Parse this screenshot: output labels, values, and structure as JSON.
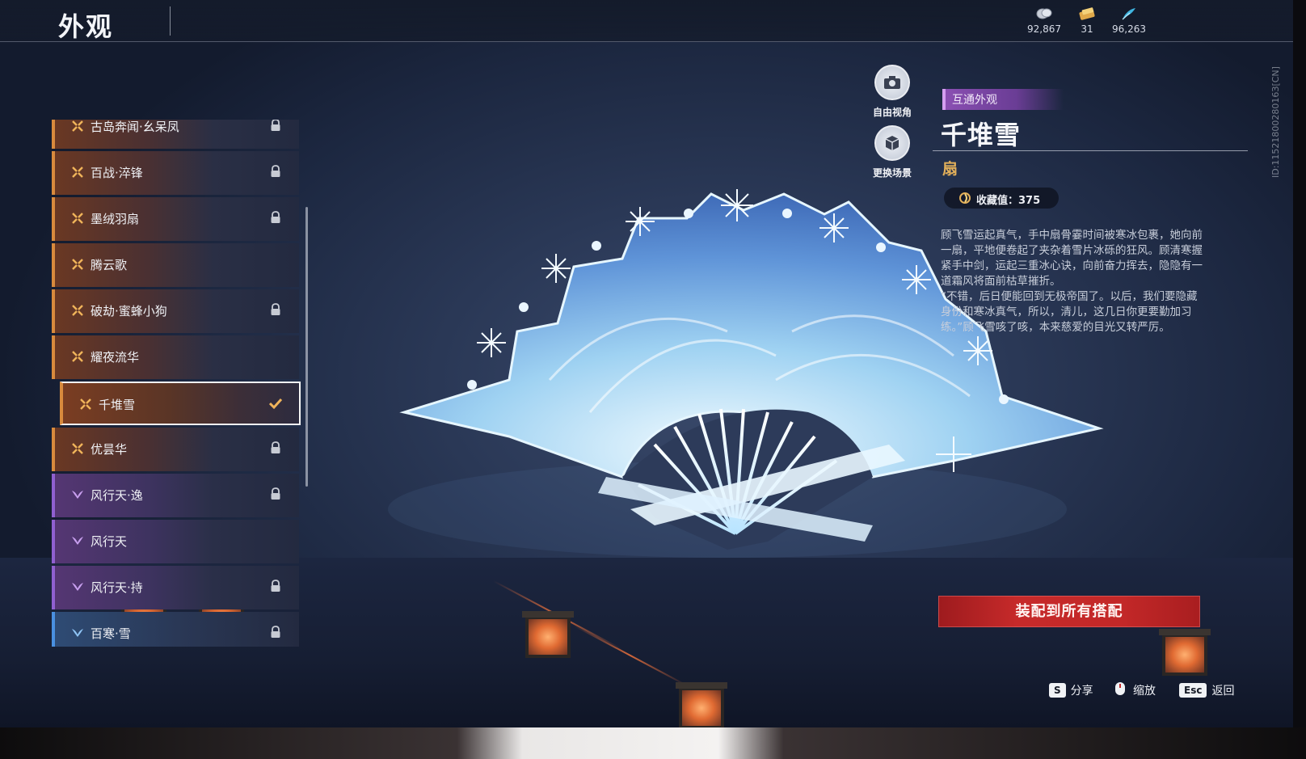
{
  "header": {
    "title": "外观"
  },
  "currencies": [
    {
      "icon": "silver-coin-icon",
      "value": "92,867"
    },
    {
      "icon": "ticket-icon",
      "value": "31"
    },
    {
      "icon": "feather-icon",
      "value": "96,263"
    }
  ],
  "uid": "ID:1152180028016З[CN]",
  "list": {
    "items": [
      {
        "label": "古岛奔闻·幺呆凤",
        "locked": true,
        "tier": "orange"
      },
      {
        "label": "百战·淬锋",
        "locked": true,
        "tier": "orange"
      },
      {
        "label": "墨绒羽扇",
        "locked": true,
        "tier": "orange"
      },
      {
        "label": "腾云歌",
        "locked": false,
        "tier": "orange"
      },
      {
        "label": "破劫·蜜蜂小狗",
        "locked": true,
        "tier": "orange"
      },
      {
        "label": "耀夜流华",
        "locked": false,
        "tier": "orange"
      },
      {
        "label": "千堆雪",
        "locked": false,
        "tier": "orange",
        "selected": true
      },
      {
        "label": "优昙华",
        "locked": true,
        "tier": "orange"
      },
      {
        "label": "风行天·逸",
        "locked": true,
        "tier": "purple"
      },
      {
        "label": "风行天",
        "locked": false,
        "tier": "purple"
      },
      {
        "label": "风行天·持",
        "locked": true,
        "tier": "purple"
      },
      {
        "label": "百寒·雪",
        "locked": true,
        "tier": "blue"
      }
    ]
  },
  "side_buttons": {
    "free_view": "自由视角",
    "change_scene": "更换场景"
  },
  "detail": {
    "tag": "互通外观",
    "name": "千堆雪",
    "type": "扇",
    "collect_label": "收藏值：375",
    "description": [
      "顾飞雪运起真气，手中扇骨霎时间被寒冰包裹，她向前一扇，平地便卷起了夹杂着雪片冰砾的狂风。顾清寒握紧手中剑，运起三重冰心诀，向前奋力挥去，隐隐有一道霜风将面前枯草摧折。",
      "“不错，后日便能回到无极帝国了。以后，我们要隐藏身份和寒冰真气，所以，清儿，这几日你更要勤加习练。”顾飞雪咳了咳，本来慈爱的目光又转严厉。"
    ]
  },
  "equip_button": "装配到所有搭配",
  "hints": [
    {
      "key": "S",
      "label": "分享"
    },
    {
      "key": "mouse-icon",
      "label": "缩放"
    },
    {
      "key": "Esc",
      "label": "返回"
    }
  ],
  "colors": {
    "orange_tier": "#d88a3d",
    "purple_tier": "#9060d0",
    "blue_tier": "#4a90e0",
    "equip_red": "#c62a2a",
    "type_gold": "#e3b05a"
  }
}
